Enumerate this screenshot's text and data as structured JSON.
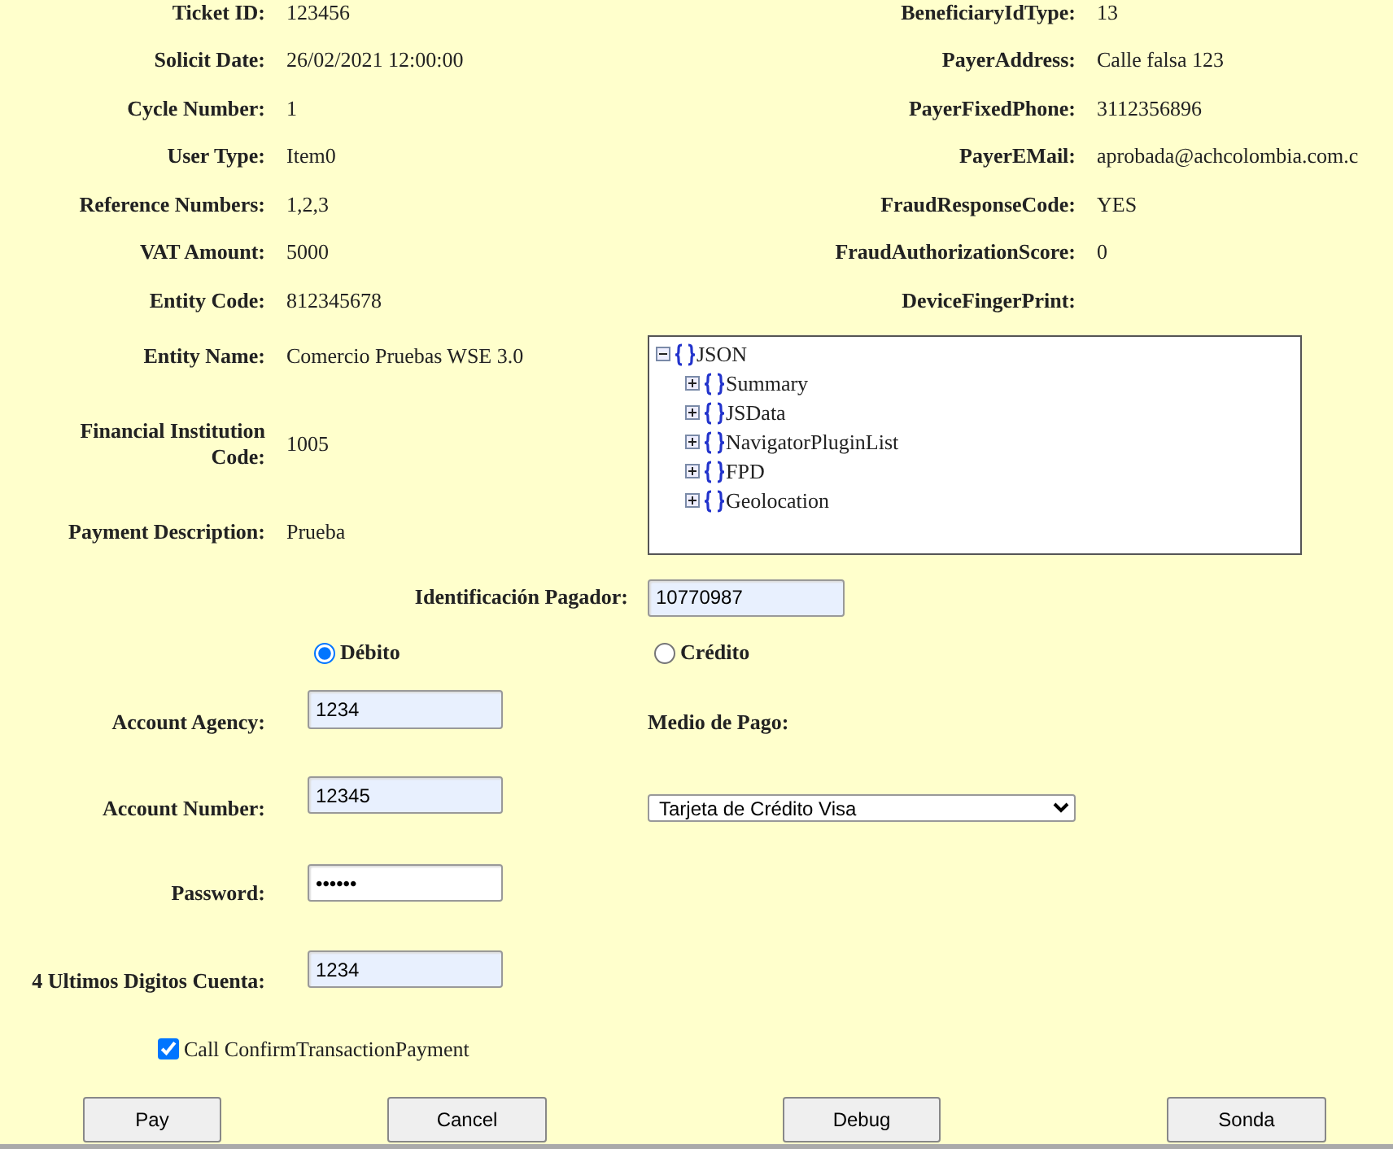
{
  "details_left": [
    {
      "label": "Ticket ID:",
      "value": "123456"
    },
    {
      "label": "Solicit Date:",
      "value": "26/02/2021 12:00:00"
    },
    {
      "label": "Cycle Number:",
      "value": "1"
    },
    {
      "label": "User Type:",
      "value": "Item0"
    },
    {
      "label": "Reference Numbers:",
      "value": "1,2,3"
    },
    {
      "label": "VAT Amount:",
      "value": "5000"
    },
    {
      "label": "Entity Code:",
      "value": "812345678"
    },
    {
      "label": "Entity Name:",
      "value": "Comercio Pruebas WSE 3.0"
    },
    {
      "label": "Financial Institution Code:",
      "value": "1005"
    },
    {
      "label": "Payment Description:",
      "value": "Prueba"
    }
  ],
  "details_right": [
    {
      "label": "BeneficiaryIdType:",
      "value": "13"
    },
    {
      "label": "PayerAddress:",
      "value": "Calle falsa 123"
    },
    {
      "label": "PayerFixedPhone:",
      "value": "3112356896"
    },
    {
      "label": "PayerEMail:",
      "value": "aprobada@achcolombia.com.c"
    },
    {
      "label": "FraudResponseCode:",
      "value": "YES"
    },
    {
      "label": "FraudAuthorizationScore:",
      "value": "0"
    },
    {
      "label": "DeviceFingerPrint:"
    }
  ],
  "json_tree": {
    "label": "JSON",
    "expanded": true,
    "children": [
      {
        "label": "Summary",
        "expanded": false
      },
      {
        "label": "JSData",
        "expanded": false
      },
      {
        "label": "NavigatorPluginList",
        "expanded": false
      },
      {
        "label": "FPD",
        "expanded": false
      },
      {
        "label": "Geolocation",
        "expanded": false
      }
    ]
  },
  "payer_id": {
    "label": "Identificación Pagador:",
    "value": "10770987",
    "autofilled": true
  },
  "payment_type": [
    {
      "label": "Débito",
      "selected": true
    },
    {
      "label": "Crédito",
      "selected": false
    }
  ],
  "account_fields": [
    {
      "label": "Account Agency:",
      "value": "1234",
      "autofilled": true
    },
    {
      "label": "Account Number:",
      "value": "12345",
      "autofilled": true
    },
    {
      "label": "Password:",
      "value": "••••••",
      "autofilled": false
    },
    {
      "label": "4 Ultimos Digitos Cuenta:",
      "value": "1234",
      "autofilled": true
    }
  ],
  "payment_method": {
    "label": "Medio de Pago:",
    "value": "Tarjeta de Crédito Visa"
  },
  "confirm_option": {
    "label": "Call ConfirmTransactionPayment",
    "checked": true
  },
  "buttons": [
    "Pay",
    "Cancel",
    "Debug",
    "Sonda"
  ]
}
